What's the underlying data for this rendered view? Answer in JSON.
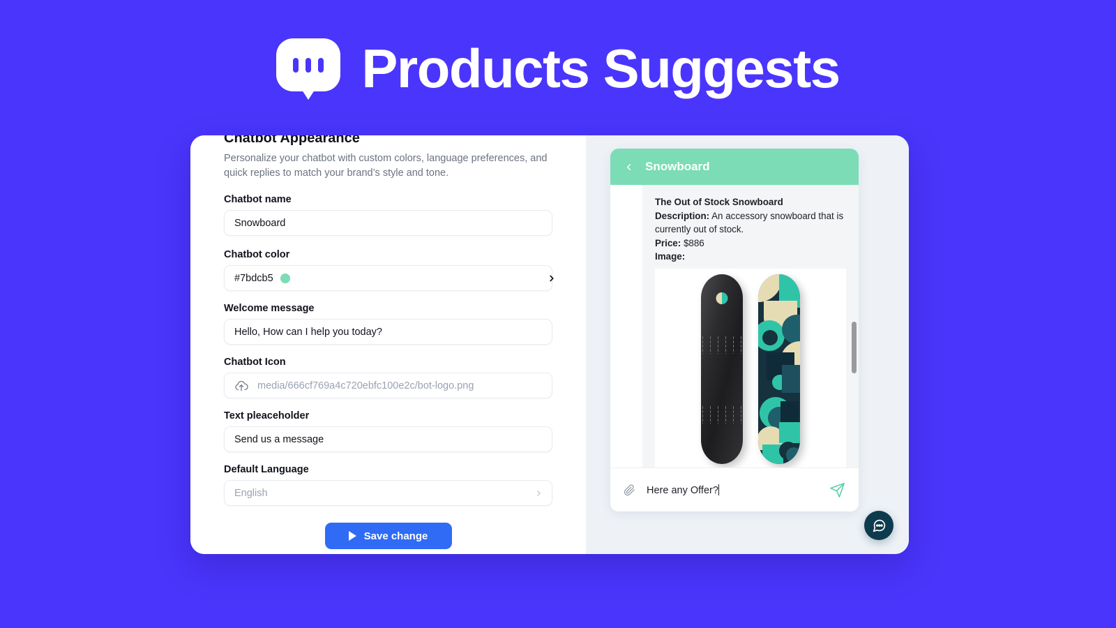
{
  "hero": {
    "title": "Products Suggests",
    "logo_icon": "chat-bubble-dots-logo",
    "background_color": "#4a35fc",
    "text_color": "#ffffff"
  },
  "settings": {
    "heading": "Chatbot Appearance",
    "subtitle": "Personalize your chatbot with custom colors, language preferences, and quick replies to match your brand’s style and tone.",
    "fields": [
      {
        "label": "Chatbot name",
        "value": "Snowboard"
      },
      {
        "label": "Chatbot color",
        "value": "#7bdcb5",
        "swatch_color": "#7bdcb5"
      },
      {
        "label": "Welcome message",
        "value": "Hello, How can I help you today?"
      },
      {
        "label": "Chatbot Icon",
        "value": "media/666cf769a4c720ebfc100e2c/bot-logo.png",
        "icon": "cloud-upload-icon"
      },
      {
        "label": "Text pleaceholder",
        "value": "Send us a message"
      },
      {
        "label": "Default Language",
        "value": "English"
      }
    ],
    "save_button": {
      "label": "Save change",
      "icon": "play-icon",
      "color": "#2f6bf5"
    }
  },
  "preview": {
    "chat": {
      "header": {
        "title": "Snowboard",
        "back_icon": "chevron-left-icon",
        "background_color": "#7bdcb5"
      },
      "message": {
        "title": "The Out of Stock Snowboard",
        "description_label": "Description:",
        "description": "An accessory snowboard that is currently out of stock.",
        "price_label": "Price:",
        "price": "$886",
        "image_label": "Image:",
        "image_alt": "two-snowboards-dark-and-patterned"
      },
      "input": {
        "value": "Here any Offer?",
        "attach_icon": "paperclip-icon",
        "send_icon": "send-plane-icon"
      },
      "scrollbar": "vertical-scrollbar"
    },
    "fab": {
      "icon": "chat-bubble-dots-icon",
      "color": "#0e3a4d"
    },
    "background_color": "#eef2f7"
  }
}
